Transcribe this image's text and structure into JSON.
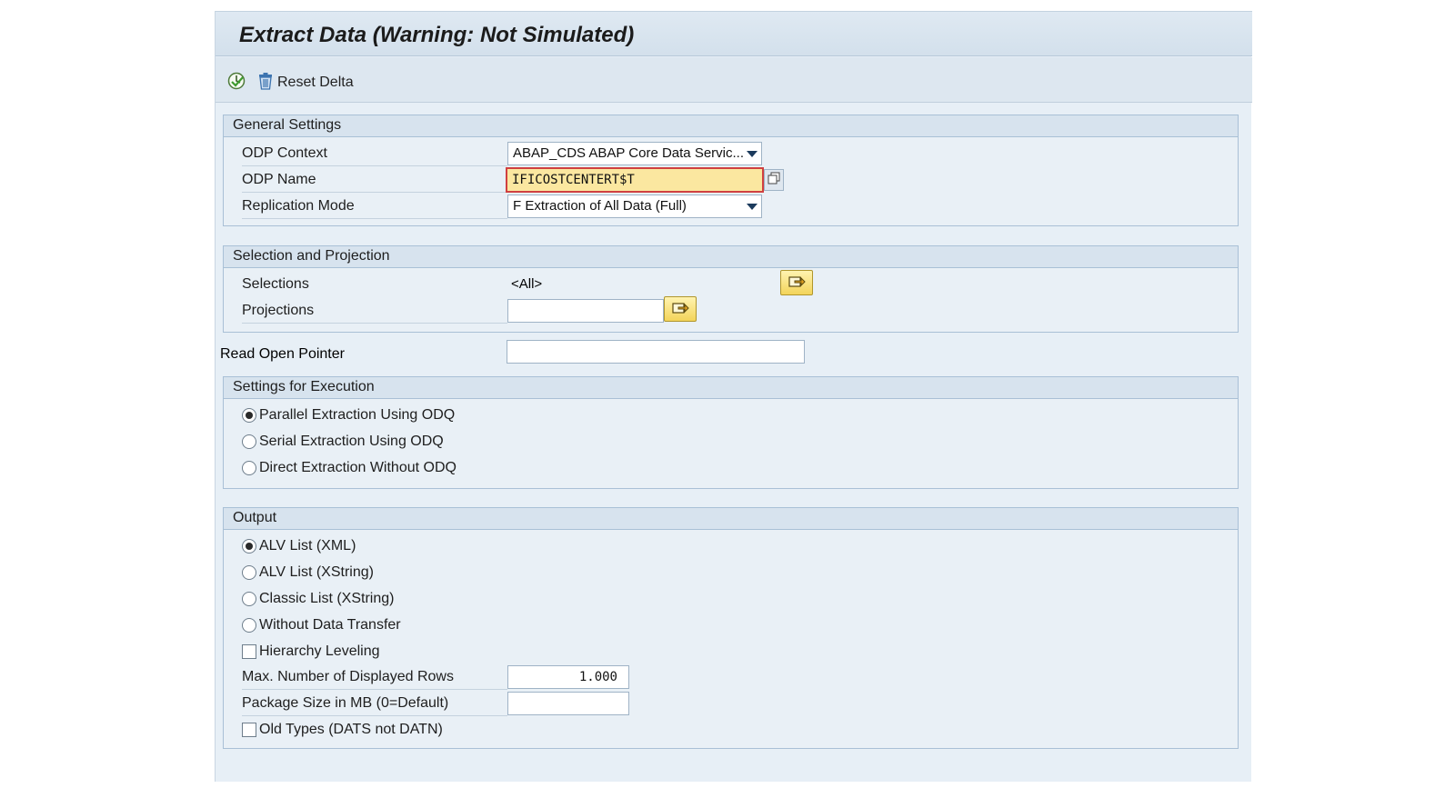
{
  "window": {
    "title": "Extract Data (Warning: Not Simulated)"
  },
  "toolbar": {
    "execute_icon": "execute-clock-icon",
    "reset_delta_icon": "trash-icon",
    "reset_delta_label": "Reset Delta"
  },
  "general_settings": {
    "header": "General Settings",
    "odp_context": {
      "label": "ODP Context",
      "value": "ABAP_CDS ABAP Core Data Servic..."
    },
    "odp_name": {
      "label": "ODP Name",
      "value": "IFICOSTCENTERT$T"
    },
    "replication_mode": {
      "label": "Replication Mode",
      "value": "F Extraction of All Data (Full)"
    }
  },
  "selection_projection": {
    "header": "Selection and Projection",
    "selections": {
      "label": "Selections",
      "value": "<All>"
    },
    "projections": {
      "label": "Projections",
      "value": ""
    }
  },
  "read_open_pointer": {
    "label": "Read Open Pointer",
    "value": ""
  },
  "execution": {
    "header": "Settings for Execution",
    "options": [
      {
        "label": "Parallel Extraction Using ODQ",
        "selected": true
      },
      {
        "label": "Serial Extraction Using ODQ",
        "selected": false
      },
      {
        "label": "Direct Extraction Without ODQ",
        "selected": false
      }
    ]
  },
  "output": {
    "header": "Output",
    "options": [
      {
        "label": "ALV List (XML)",
        "selected": true
      },
      {
        "label": "ALV List (XString)",
        "selected": false
      },
      {
        "label": "Classic List (XString)",
        "selected": false
      },
      {
        "label": "Without Data Transfer",
        "selected": false
      }
    ],
    "hierarchy_leveling": {
      "label": "Hierarchy Leveling",
      "checked": false
    },
    "max_rows": {
      "label": "Max. Number of Displayed Rows",
      "value": "1.000"
    },
    "package_size": {
      "label": "Package Size in MB (0=Default)",
      "value": ""
    },
    "old_types": {
      "label": "Old Types (DATS not DATN)",
      "checked": false
    }
  },
  "colors": {
    "panel_bg": "#e9f0f6",
    "header_bg": "#d7e3ee",
    "active_field": "#fbe7a0",
    "active_border": "#d04040"
  }
}
